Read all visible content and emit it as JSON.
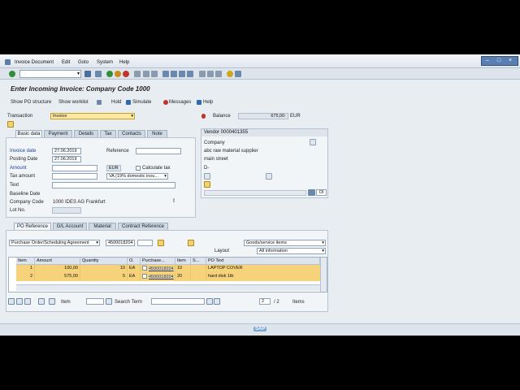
{
  "menu": {
    "items": [
      "Invoice Document",
      "Edit",
      "Goto",
      "System",
      "Help"
    ],
    "sap_logo": "SAP"
  },
  "title": "Enter Incoming Invoice: Company Code 1000",
  "app_toolbar": {
    "show_po_structure": "Show PO structure",
    "show_worklist": "Show worklist",
    "hold": "Hold",
    "simulate": "Simulate",
    "messages": "Messages",
    "help": "Help"
  },
  "header": {
    "transaction_label": "Transaction",
    "transaction_value": "Invoice",
    "balance_label": "Balance",
    "balance_value": "675,00-",
    "balance_currency": "EUR"
  },
  "basic_tabs": [
    "Basic data",
    "Payment",
    "Details",
    "Tax",
    "Contacts",
    "Note"
  ],
  "basic": {
    "invoice_date_label": "Invoice date",
    "invoice_date": "27.06.2019",
    "reference_label": "Reference",
    "posting_date_label": "Posting Date",
    "posting_date": "27.06.2019",
    "amount_label": "Amount",
    "amount_currency": "EUR",
    "calculate_tax_label": "Calculate tax",
    "tax_amount_label": "Tax amount",
    "tax_code": "VA (19% domestic inou...",
    "text_label": "Text",
    "baseline_date_label": "Baseline Date",
    "company_code_label": "Company Code",
    "company_code_value": "1000 IDES AG Frankfurt",
    "lot_no_label": "Lot No."
  },
  "vendor": {
    "title": "Vendor 0000401355",
    "company_label": "Company",
    "name": "abc raw material supplier",
    "street": "main street",
    "city": "D-",
    "oi_button": "OI"
  },
  "po_tabs": [
    "PO Reference",
    "G/L Account",
    "Material",
    "Contract Reference"
  ],
  "po_ref": {
    "type": "Purchase Order/Scheduling Agreement",
    "po_number": "4500018204",
    "goods_service": "Goods/service items",
    "layout_label": "Layout",
    "layout_value": "All information"
  },
  "table": {
    "columns": [
      "Item",
      "Amount",
      "Quantity",
      "O.",
      "Purchase...",
      "Item",
      "S...",
      "PO Text"
    ],
    "rows": [
      {
        "item": "1",
        "amount": "100,00",
        "quantity": "10",
        "unit": "EA",
        "po": "4500018204",
        "po_item": "10",
        "text": "LAPTOP COVER"
      },
      {
        "item": "2",
        "amount": "575,00",
        "quantity": "5",
        "unit": "EA",
        "po": "4500018204",
        "po_item": "20",
        "text": "hard disk 1tb"
      }
    ]
  },
  "bottom": {
    "item_label": "Item",
    "search_label": "Search Term",
    "page": "2",
    "page_total": "/ 2",
    "items_label": "Items"
  }
}
